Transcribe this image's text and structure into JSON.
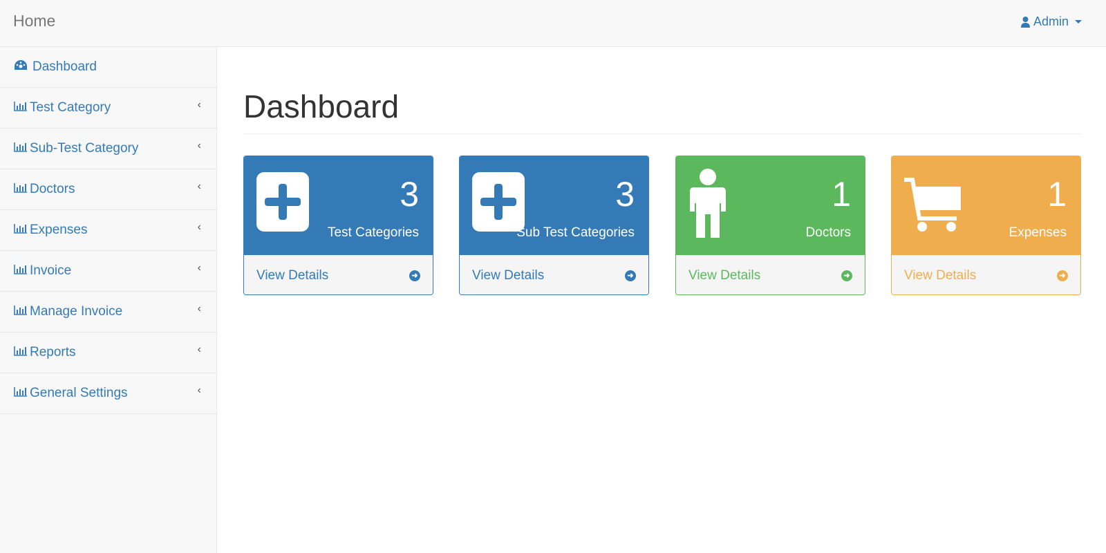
{
  "navbar": {
    "brand": "Home",
    "user": "Admin",
    "user_icon": "user-icon"
  },
  "sidebar": {
    "items": [
      {
        "label": "Dashboard",
        "icon": "dashboard-icon"
      },
      {
        "label": "Test Category",
        "icon": "bar-chart-icon"
      },
      {
        "label": "Sub-Test Category",
        "icon": "bar-chart-icon"
      },
      {
        "label": "Doctors",
        "icon": "bar-chart-icon"
      },
      {
        "label": "Expenses",
        "icon": "bar-chart-icon"
      },
      {
        "label": "Invoice",
        "icon": "bar-chart-icon"
      },
      {
        "label": "Manage Invoice",
        "icon": "bar-chart-icon"
      },
      {
        "label": "Reports",
        "icon": "bar-chart-icon"
      },
      {
        "label": "General Settings",
        "icon": "bar-chart-icon"
      }
    ]
  },
  "page": {
    "title": "Dashboard"
  },
  "cards": [
    {
      "count": "3",
      "label": "Test Categories",
      "link": "View Details",
      "color": "#337ab7",
      "icon": "plus-square-icon"
    },
    {
      "count": "3",
      "label": "Sub Test Categories",
      "link": "View Details",
      "color": "#337ab7",
      "icon": "plus-square-icon"
    },
    {
      "count": "1",
      "label": "Doctors",
      "link": "View Details",
      "color": "#5cb85c",
      "icon": "user-icon"
    },
    {
      "count": "1",
      "label": "Expenses",
      "link": "View Details",
      "color": "#f0ad4e",
      "icon": "shopping-cart-icon"
    }
  ]
}
